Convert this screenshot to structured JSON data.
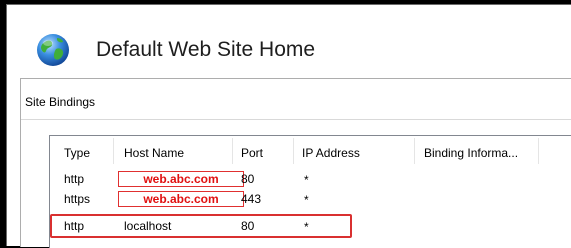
{
  "window": {
    "title": "Default Web Site Home",
    "icon": "globe-icon"
  },
  "dialog": {
    "title": "Site Bindings"
  },
  "bindings": {
    "columns": [
      "Type",
      "Host Name",
      "Port",
      "IP Address",
      "Binding Informa..."
    ],
    "rows": [
      {
        "type": "http",
        "host": "web.abc.com",
        "port": "80",
        "ip": "*"
      },
      {
        "type": "https",
        "host": "web.abc.com",
        "port": "443",
        "ip": "*"
      },
      {
        "type": "http",
        "host": "localhost",
        "port": "80",
        "ip": "*"
      }
    ]
  },
  "colors": {
    "highlight": "#e03030",
    "window_bg": "#ffffff",
    "background": "#000000"
  }
}
